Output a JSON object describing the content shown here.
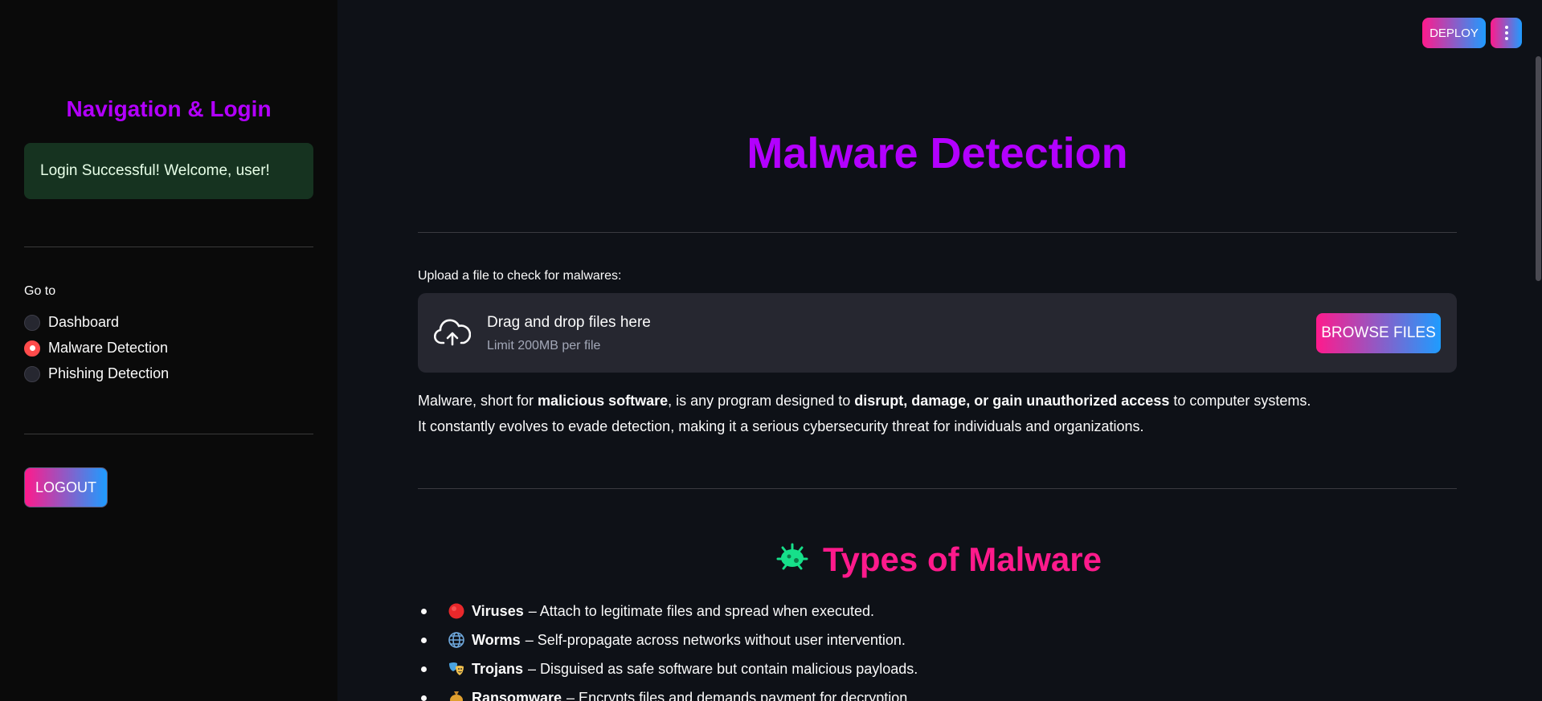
{
  "sidebar": {
    "title": "Navigation & Login",
    "login_message": "Login Successful! Welcome, user!",
    "goto_label": "Go to",
    "nav_options": [
      {
        "label": "Dashboard",
        "selected": false
      },
      {
        "label": "Malware Detection",
        "selected": true
      },
      {
        "label": "Phishing Detection",
        "selected": false
      }
    ],
    "logout_label": "LOGOUT"
  },
  "toolbar": {
    "deploy_label": "DEPLOY",
    "menu_icon": "vertical-ellipsis-icon"
  },
  "main": {
    "title": "Malware Detection",
    "upload": {
      "label": "Upload a file to check for malwares:",
      "drop_text": "Drag and drop files here",
      "limit_text": "Limit 200MB per file",
      "browse_label": "BROWSE FILES",
      "icon": "cloud-upload-icon"
    },
    "intro": {
      "line1_a": "Malware, short for ",
      "line1_b": "malicious software",
      "line1_c": ", is any program designed to ",
      "line1_d": "disrupt, damage, or gain unauthorized access",
      "line1_e": " to computer systems.",
      "line2": "It constantly evolves to evade detection, making it a serious cybersecurity threat for individuals and organizations."
    },
    "types_heading": "Types of Malware",
    "types_icon": "microbe-icon",
    "types": [
      {
        "name": "Viruses",
        "desc": "– Attach to legitimate files and spread when executed.",
        "icon": "red-circle-icon"
      },
      {
        "name": "Worms",
        "desc": "– Self-propagate across networks without user intervention.",
        "icon": "globe-icon"
      },
      {
        "name": "Trojans",
        "desc": "– Disguised as safe software but contain malicious payloads.",
        "icon": "masks-icon"
      },
      {
        "name": "Ransomware",
        "desc": "– Encrypts files and demands payment for decryption.",
        "icon": "money-bag-icon"
      }
    ]
  },
  "colors": {
    "accent_purple": "#b300ff",
    "accent_pink": "#ff1a8c",
    "gradient_blue": "#1e9cff",
    "success_bg": "#163320"
  }
}
